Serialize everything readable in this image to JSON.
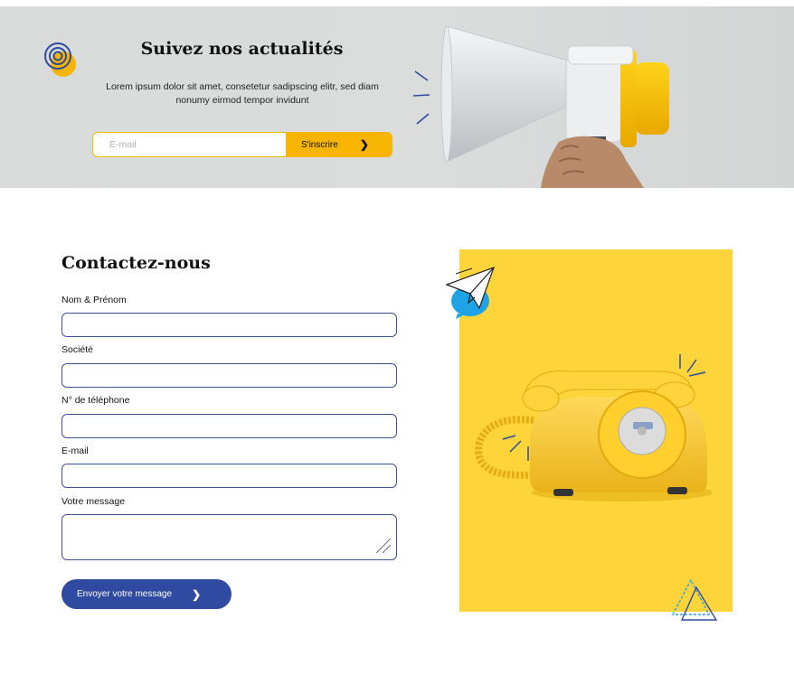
{
  "newsletter": {
    "title": "Suivez nos actualités",
    "text": "Lorem ipsum dolor sit amet, consetetur sadipscing elitr, sed diam nonumy eirmod tempor invidunt",
    "email_placeholder": "E-mail",
    "subscribe_label": "S'inscrire",
    "subscribe_icon": "chevron-right-icon"
  },
  "contact": {
    "title": "Contactez-nous",
    "fields": [
      {
        "label": "Nom & Prénom",
        "value": ""
      },
      {
        "label": "Société",
        "value": ""
      },
      {
        "label": "N° de téléphone",
        "value": ""
      },
      {
        "label": "E-mail",
        "value": ""
      },
      {
        "label": "Votre message",
        "value": ""
      }
    ],
    "submit_label": "Envoyer votre message",
    "submit_icon": "chevron-right-icon"
  },
  "colors": {
    "accent_yellow": "#f7b500",
    "panel_yellow": "#fed43b",
    "primary_blue": "#2f4aa0",
    "banner_bg": "#d9dcdb"
  }
}
